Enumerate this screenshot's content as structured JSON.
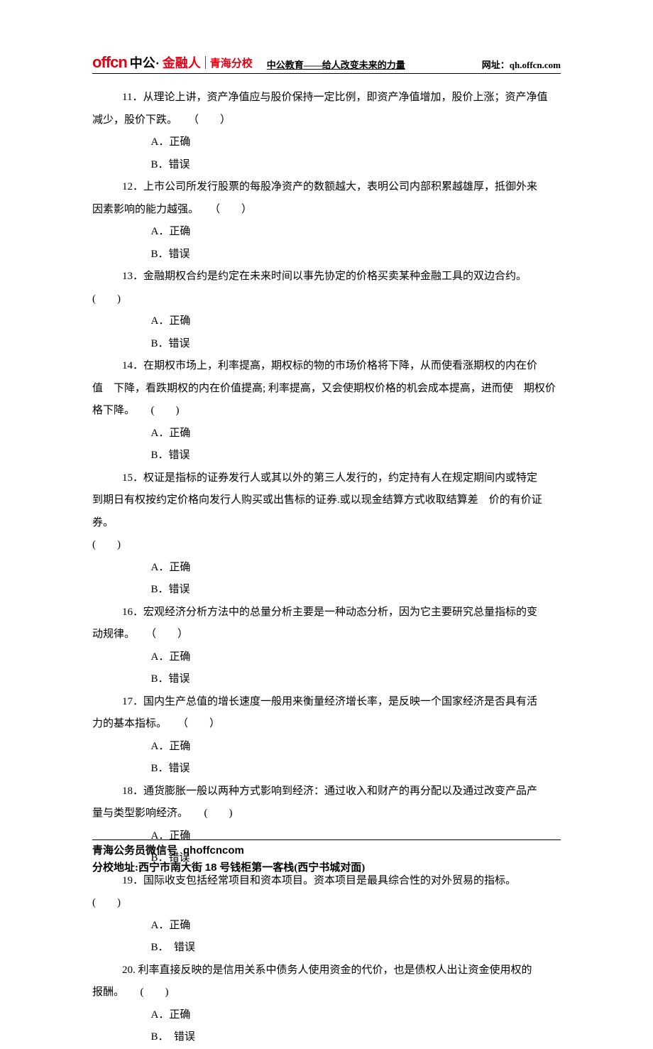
{
  "header": {
    "logo_offcn": "offcn",
    "logo_zhonggong": "中公·",
    "logo_jinrongren": "金融人",
    "logo_qinghai": "青海分校",
    "slogan": "中公教育——给人改变未来的力量",
    "url_label": "网址：qh.offcn.com"
  },
  "questions": [
    {
      "text_lines": [
        "11．从理论上讲，资产净值应与股价保持一定比例，即资产净值增加，股价上涨；资产净值"
      ],
      "cont_lines": [
        "减少，股价下跌。　　（　　）"
      ],
      "options": [
        "A．正确",
        "B．错误"
      ]
    },
    {
      "text_lines": [
        "12．上市公司所发行股票的每股净资产的数额越大，表明公司内部积累越雄厚，抵御外来"
      ],
      "cont_lines": [
        "因素影响的能力越强。　　（　　）"
      ],
      "options": [
        "A．正确",
        "B．错误"
      ]
    },
    {
      "text_lines": [
        "13．金融期权合约是约定在未来时间以事先协定的价格买卖某种金融工具的双边合约。"
      ],
      "cont_lines": [
        "(　　)"
      ],
      "options": [
        "A．正确",
        "B．错误"
      ]
    },
    {
      "text_lines": [
        "14．在期权市场上，利率提高，期权标的物的市场价格将下降，从而使看涨期权的内在价"
      ],
      "cont_lines": [
        "值　下降，看跌期权的内在价值提高; 利率提高，又会使期权价格的机会成本提高，进而使　期权价",
        "格下降。　　(　　)"
      ],
      "options": [
        "A．正确",
        "B．错误"
      ]
    },
    {
      "text_lines": [
        "15．权证是指标的证券发行人或其以外的第三人发行的，约定持有人在规定期间内或特定"
      ],
      "cont_lines": [
        "到期日有权按约定价格向发行人购买或出售标的证券.或以现金结算方式收取结算差　价的有价证券。",
        "(　　)"
      ],
      "options": [
        "A．正确",
        "B．错误"
      ]
    },
    {
      "text_lines": [
        "16．宏观经济分析方法中的总量分析主要是一种动态分析，因为它主要研究总量指标的变"
      ],
      "cont_lines": [
        "动规律。　　（　　）"
      ],
      "options": [
        "A．正确",
        "B．错误"
      ]
    },
    {
      "text_lines": [
        "17．国内生产总值的增长速度一般用来衡量经济增长率，是反映一个国家经济是否具有活"
      ],
      "cont_lines": [
        "力的基本指标。　　（　　）"
      ],
      "options": [
        "A．正确",
        "B．错误"
      ]
    },
    {
      "text_lines": [
        "18．通货膨胀一般以两种方式影响到经济：通过收入和财产的再分配以及通过改变产品产"
      ],
      "cont_lines": [
        "量与类型影响经济。　　(　　)"
      ],
      "options": [
        "A．正确",
        "B．错误"
      ]
    },
    {
      "text_lines": [
        "19．国际收支包括经常项目和资本项目。资本项目是最具综合性的对外贸易的指标。"
      ],
      "cont_lines": [
        "(　　)"
      ],
      "options": [
        "A．正确",
        "B．　错误"
      ]
    },
    {
      "text_lines": [
        "20. 利率直接反映的是信用关系中债务人使用资金的代价，也是债权人出让资金使用权的"
      ],
      "cont_lines": [
        "报酬。　　(　　)"
      ],
      "options": [
        "A．正确",
        "B．　错误"
      ]
    }
  ],
  "footer": {
    "wechat_label": "青海公务员微信号",
    "wechat_id": "qhoffcncom",
    "address_label": "分校地址:",
    "address_part1": "西宁市南大街 ",
    "address_num": "18",
    "address_part2": " 号钱柜第一客栈(西宁书城对面)"
  }
}
